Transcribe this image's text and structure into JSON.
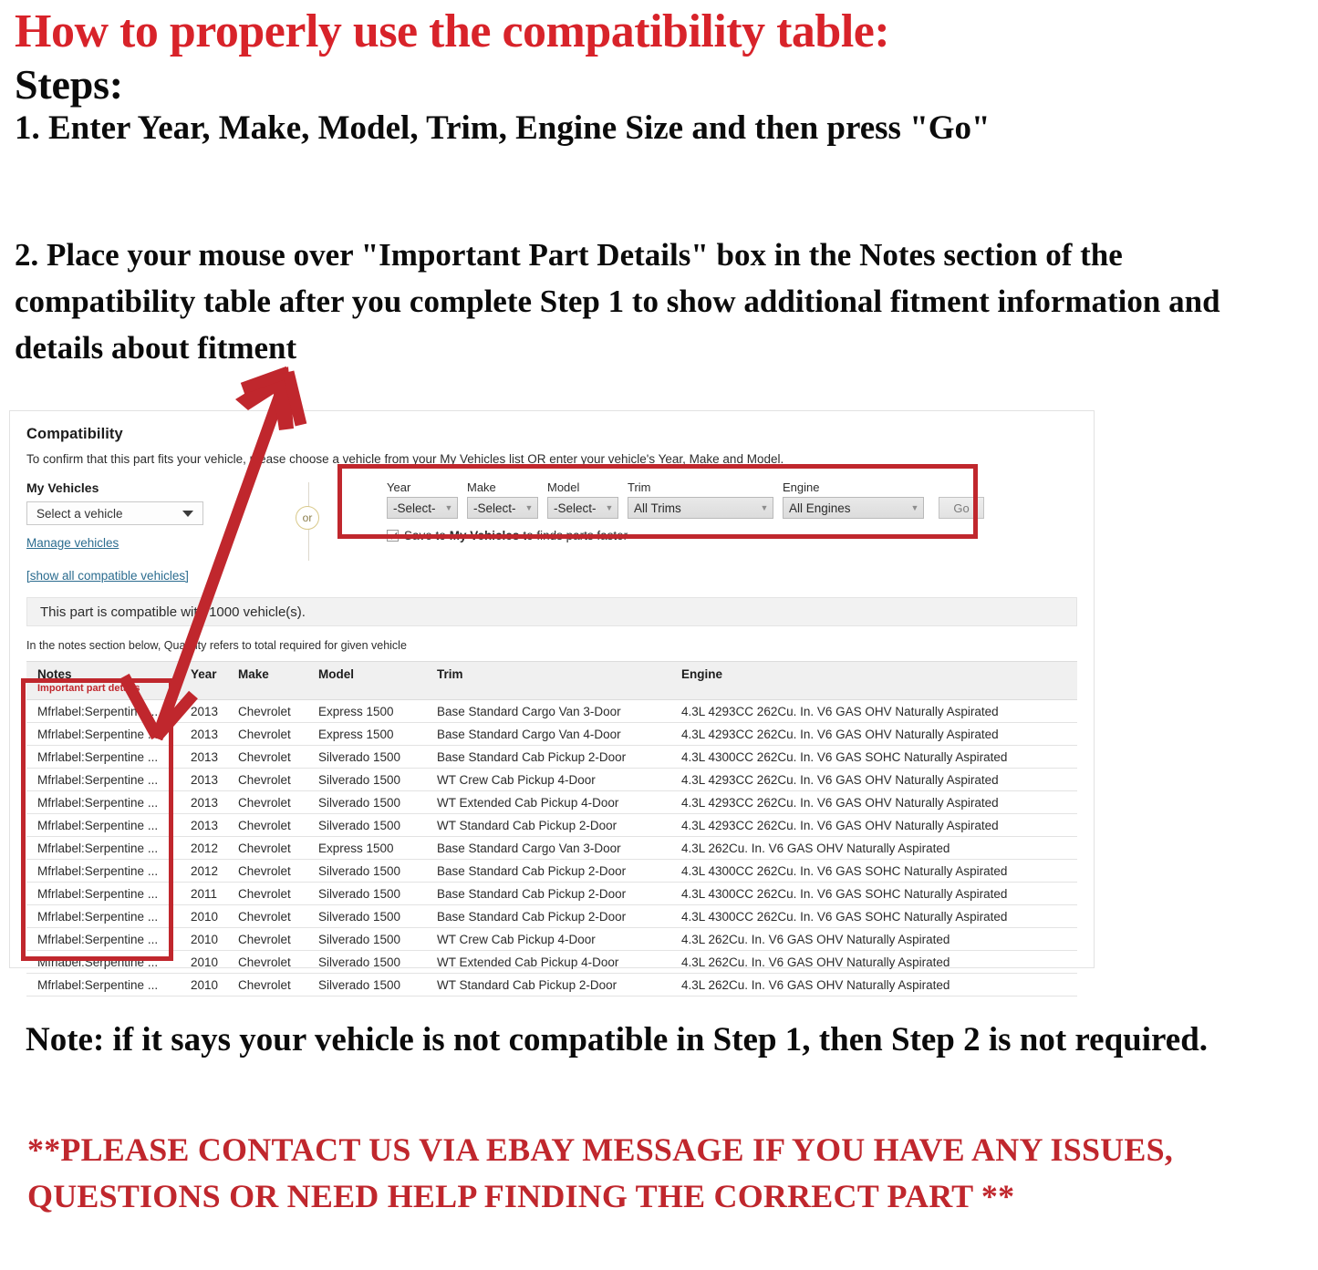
{
  "instructions": {
    "headline": "How to properly use the compatibility table:",
    "steps_label": "Steps:",
    "step_one": "1. Enter Year, Make, Model, Trim, Engine Size and then press \"Go\"",
    "step_two": "2. Place your mouse over \"Important Part Details\" box in the Notes section of the compatibility table after you complete Step 1 to show additional fitment information and details about fitment"
  },
  "compatibility": {
    "title": "Compatibility",
    "subtitle": "To confirm that this part fits your vehicle, please choose a vehicle from your My Vehicles list OR enter your vehicle's Year, Make and Model.",
    "my_vehicles": {
      "label": "My Vehicles",
      "select_value": "Select a vehicle",
      "manage_link": "Manage vehicles"
    },
    "or_divider": "or",
    "selectors": [
      {
        "label": "Year",
        "value": "-Select-"
      },
      {
        "label": "Make",
        "value": "-Select-"
      },
      {
        "label": "Model",
        "value": "-Select-"
      },
      {
        "label": "Trim",
        "value": "All Trims"
      },
      {
        "label": "Engine",
        "value": "All Engines"
      }
    ],
    "go_button": "Go",
    "save_checkbox": {
      "prefix": "Save to",
      "strong": "My Vehicles",
      "suffix": "to finds parts faster",
      "checked": true
    },
    "show_all_link": "[show all compatible vehicles]",
    "count_banner": "This part is compatible with 1000 vehicle(s).",
    "qty_note": "In the notes section below, Quantity refers to total required for given vehicle",
    "table": {
      "headers": {
        "notes": "Notes",
        "notes_sub": "Important part details",
        "year": "Year",
        "make": "Make",
        "model": "Model",
        "trim": "Trim",
        "engine": "Engine"
      },
      "rows": [
        {
          "notes": "Mfrlabel:Serpentine ...",
          "year": "2013",
          "make": "Chevrolet",
          "model": "Express 1500",
          "trim": "Base Standard Cargo Van 3-Door",
          "engine": "4.3L 4293CC 262Cu. In. V6 GAS OHV Naturally Aspirated"
        },
        {
          "notes": "Mfrlabel:Serpentine ...",
          "year": "2013",
          "make": "Chevrolet",
          "model": "Express 1500",
          "trim": "Base Standard Cargo Van 4-Door",
          "engine": "4.3L 4293CC 262Cu. In. V6 GAS OHV Naturally Aspirated"
        },
        {
          "notes": "Mfrlabel:Serpentine ...",
          "year": "2013",
          "make": "Chevrolet",
          "model": "Silverado 1500",
          "trim": "Base Standard Cab Pickup 2-Door",
          "engine": "4.3L 4300CC 262Cu. In. V6 GAS SOHC Naturally Aspirated"
        },
        {
          "notes": "Mfrlabel:Serpentine ...",
          "year": "2013",
          "make": "Chevrolet",
          "model": "Silverado 1500",
          "trim": "WT Crew Cab Pickup 4-Door",
          "engine": "4.3L 4293CC 262Cu. In. V6 GAS OHV Naturally Aspirated"
        },
        {
          "notes": "Mfrlabel:Serpentine ...",
          "year": "2013",
          "make": "Chevrolet",
          "model": "Silverado 1500",
          "trim": "WT Extended Cab Pickup 4-Door",
          "engine": "4.3L 4293CC 262Cu. In. V6 GAS OHV Naturally Aspirated"
        },
        {
          "notes": "Mfrlabel:Serpentine ...",
          "year": "2013",
          "make": "Chevrolet",
          "model": "Silverado 1500",
          "trim": "WT Standard Cab Pickup 2-Door",
          "engine": "4.3L 4293CC 262Cu. In. V6 GAS OHV Naturally Aspirated"
        },
        {
          "notes": "Mfrlabel:Serpentine ...",
          "year": "2012",
          "make": "Chevrolet",
          "model": "Express 1500",
          "trim": "Base Standard Cargo Van 3-Door",
          "engine": "4.3L 262Cu. In. V6 GAS OHV Naturally Aspirated"
        },
        {
          "notes": "Mfrlabel:Serpentine ...",
          "year": "2012",
          "make": "Chevrolet",
          "model": "Silverado 1500",
          "trim": "Base Standard Cab Pickup 2-Door",
          "engine": "4.3L 4300CC 262Cu. In. V6 GAS SOHC Naturally Aspirated"
        },
        {
          "notes": "Mfrlabel:Serpentine ...",
          "year": "2011",
          "make": "Chevrolet",
          "model": "Silverado 1500",
          "trim": "Base Standard Cab Pickup 2-Door",
          "engine": "4.3L 4300CC 262Cu. In. V6 GAS SOHC Naturally Aspirated"
        },
        {
          "notes": "Mfrlabel:Serpentine ...",
          "year": "2010",
          "make": "Chevrolet",
          "model": "Silverado 1500",
          "trim": "Base Standard Cab Pickup 2-Door",
          "engine": "4.3L 4300CC 262Cu. In. V6 GAS SOHC Naturally Aspirated"
        },
        {
          "notes": "Mfrlabel:Serpentine ...",
          "year": "2010",
          "make": "Chevrolet",
          "model": "Silverado 1500",
          "trim": "WT Crew Cab Pickup 4-Door",
          "engine": "4.3L 262Cu. In. V6 GAS OHV Naturally Aspirated"
        },
        {
          "notes": "Mfrlabel:Serpentine ...",
          "year": "2010",
          "make": "Chevrolet",
          "model": "Silverado 1500",
          "trim": "WT Extended Cab Pickup 4-Door",
          "engine": "4.3L 262Cu. In. V6 GAS OHV Naturally Aspirated"
        },
        {
          "notes": "Mfrlabel:Serpentine ...",
          "year": "2010",
          "make": "Chevrolet",
          "model": "Silverado 1500",
          "trim": "WT Standard Cab Pickup 2-Door",
          "engine": "4.3L 262Cu. In. V6 GAS OHV Naturally Aspirated"
        }
      ]
    }
  },
  "footer": {
    "note": "Note: if it says your vehicle is not compatible in Step 1, then Step 2 is not required.",
    "contact": "**PLEASE CONTACT US VIA EBAY MESSAGE IF YOU HAVE ANY ISSUES, QUESTIONS OR NEED HELP FINDING THE CORRECT PART **"
  },
  "colors": {
    "red": "#c0272d",
    "headline_red": "#d8232a",
    "link_blue": "#2b6c8f"
  }
}
